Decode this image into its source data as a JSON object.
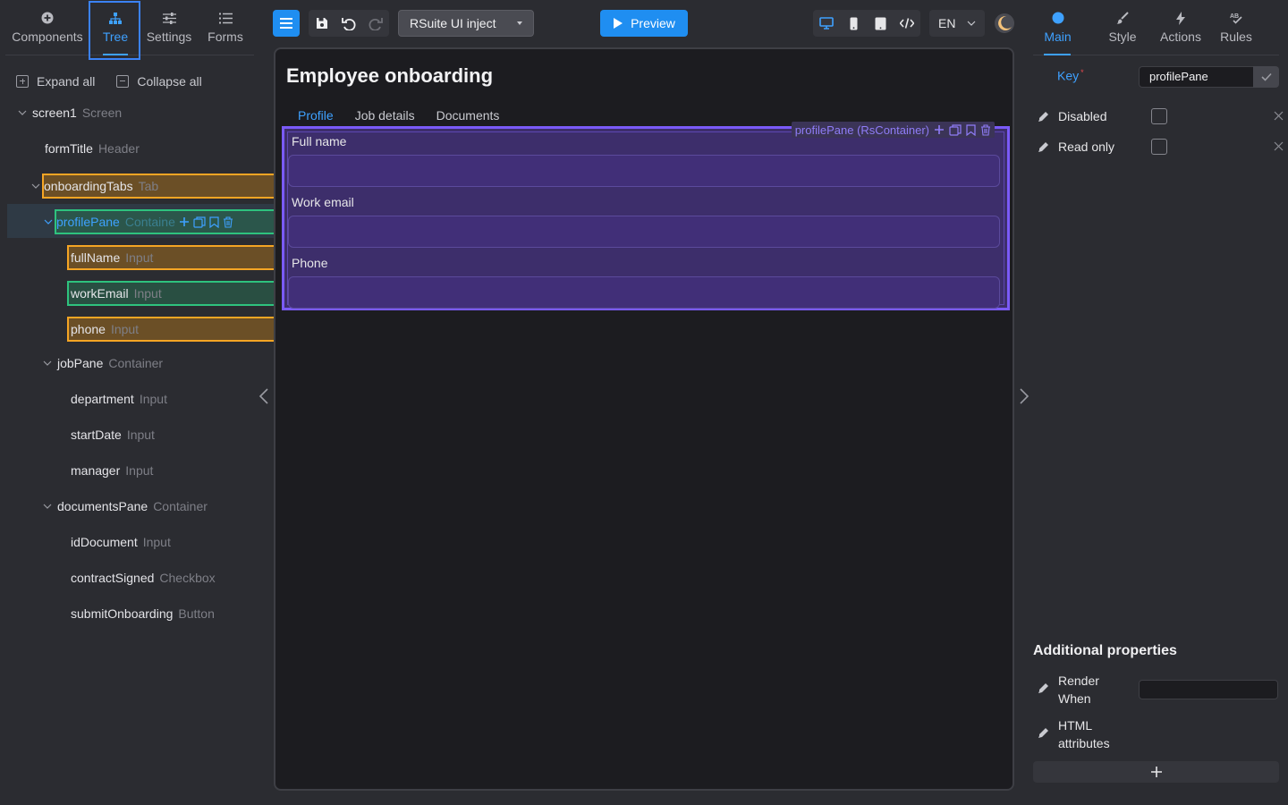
{
  "left_tabs": {
    "components": "Components",
    "tree": "Tree",
    "settings": "Settings",
    "forms": "Forms"
  },
  "tree_actions": {
    "expand_all": "Expand all",
    "collapse_all": "Collapse all"
  },
  "tree": {
    "screen1": {
      "name": "screen1",
      "type": "Screen"
    },
    "formTitle": {
      "name": "formTitle",
      "type": "Header"
    },
    "onboardingTabs": {
      "name": "onboardingTabs",
      "type": "Tab"
    },
    "profilePane": {
      "name": "profilePane",
      "type": "Containe"
    },
    "fullName": {
      "name": "fullName",
      "type": "Input"
    },
    "workEmail": {
      "name": "workEmail",
      "type": "Input"
    },
    "phone": {
      "name": "phone",
      "type": "Input"
    },
    "jobPane": {
      "name": "jobPane",
      "type": "Container"
    },
    "department": {
      "name": "department",
      "type": "Input"
    },
    "startDate": {
      "name": "startDate",
      "type": "Input"
    },
    "manager": {
      "name": "manager",
      "type": "Input"
    },
    "documentsPane": {
      "name": "documentsPane",
      "type": "Container"
    },
    "idDocument": {
      "name": "idDocument",
      "type": "Input"
    },
    "contractSigned": {
      "name": "contractSigned",
      "type": "Checkbox"
    },
    "submitOnboarding": {
      "name": "submitOnboarding",
      "type": "Button"
    }
  },
  "toolbar": {
    "theme_select": "RSuite UI inject",
    "preview": "Preview",
    "language": "EN"
  },
  "canvas": {
    "form_title": "Employee onboarding",
    "tabs": [
      "Profile",
      "Job details",
      "Documents"
    ],
    "active_tab": "Profile",
    "selected_label": "profilePane (RsContainer)",
    "fields": {
      "full_name": "Full name",
      "work_email": "Work email",
      "phone": "Phone"
    }
  },
  "right_tabs": {
    "main": "Main",
    "style": "Style",
    "actions": "Actions",
    "rules": "Rules"
  },
  "properties": {
    "key_label": "Key",
    "key_required_mark": "*",
    "key_value": "profilePane",
    "disabled_label": "Disabled",
    "readonly_label": "Read only",
    "disabled": false,
    "readonly": false
  },
  "additional": {
    "title": "Additional properties",
    "render_when_line1": "Render",
    "render_when_line2": "When",
    "html_attr_line1": "HTML",
    "html_attr_line2": "attributes",
    "add_symbol": "+"
  },
  "colors": {
    "accent": "#3ea1ff",
    "primary_button": "#1f8ef1",
    "selection_border": "#7a5af8",
    "selection_fill": "#3d2e6b",
    "tree_highlight_orange": "#f5a524",
    "tree_highlight_green": "#2ec27e"
  }
}
